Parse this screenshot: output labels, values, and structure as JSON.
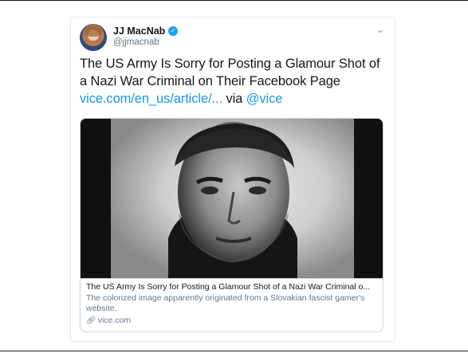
{
  "author": {
    "name": "JJ MacNab",
    "handle": "@jjmacnab"
  },
  "tweet": {
    "text": "The US Army Is Sorry for Posting a Glamour Shot of a Nazi War Criminal on Their Facebook Page",
    "link_text": "vice.com/en_us/article/...",
    "via_text": "via",
    "via_handle": "@vice"
  },
  "card": {
    "title": "The US Army Is Sorry for Posting a Glamour Shot of a Nazi War Criminal o...",
    "description": "The colorized image apparently originated from a Slovakian fascist gamer's website.",
    "domain": "vice.com"
  },
  "icons": {
    "verified": "verified-badge-icon",
    "caret": "chevron-down-icon",
    "link": "link-icon"
  },
  "colors": {
    "link": "#1b95e0",
    "verified": "#1da1f2",
    "secondary_text": "#657786",
    "border": "#ccd6dd"
  }
}
